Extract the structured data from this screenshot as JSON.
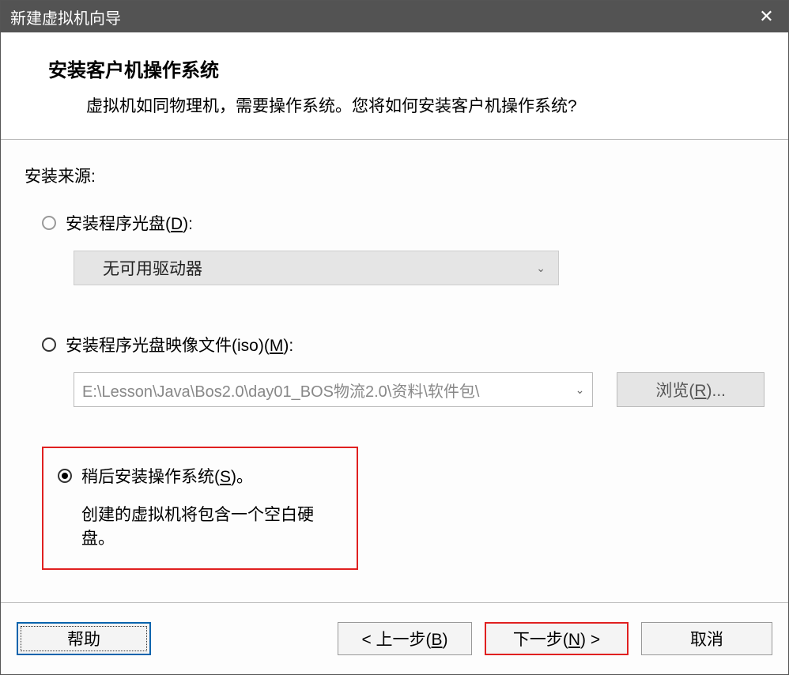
{
  "titlebar": {
    "title": "新建虚拟机向导"
  },
  "header": {
    "title": "安装客户机操作系统",
    "desc": "虚拟机如同物理机，需要操作系统。您将如何安装客户机操作系统?"
  },
  "content": {
    "source_label": "安装来源:",
    "option_disc": {
      "label_pre": "安装程序光盘(",
      "mnemonic": "D",
      "label_post": "):",
      "drive_text": "无可用驱动器"
    },
    "option_iso": {
      "label_pre": "安装程序光盘映像文件(iso)(",
      "mnemonic": "M",
      "label_post": "):",
      "path": "E:\\Lesson\\Java\\Bos2.0\\day01_BOS物流2.0\\资料\\软件包\\",
      "browse_pre": "浏览(",
      "browse_mnemonic": "R",
      "browse_post": ")..."
    },
    "option_later": {
      "label_pre": "稍后安装操作系统(",
      "mnemonic": "S",
      "label_post": ")。",
      "desc": "创建的虚拟机将包含一个空白硬盘。"
    }
  },
  "footer": {
    "help": "帮助",
    "back_pre": "< 上一步(",
    "back_mnemonic": "B",
    "back_post": ")",
    "next_pre": "下一步(",
    "next_mnemonic": "N",
    "next_post": ") >",
    "cancel": "取消"
  }
}
